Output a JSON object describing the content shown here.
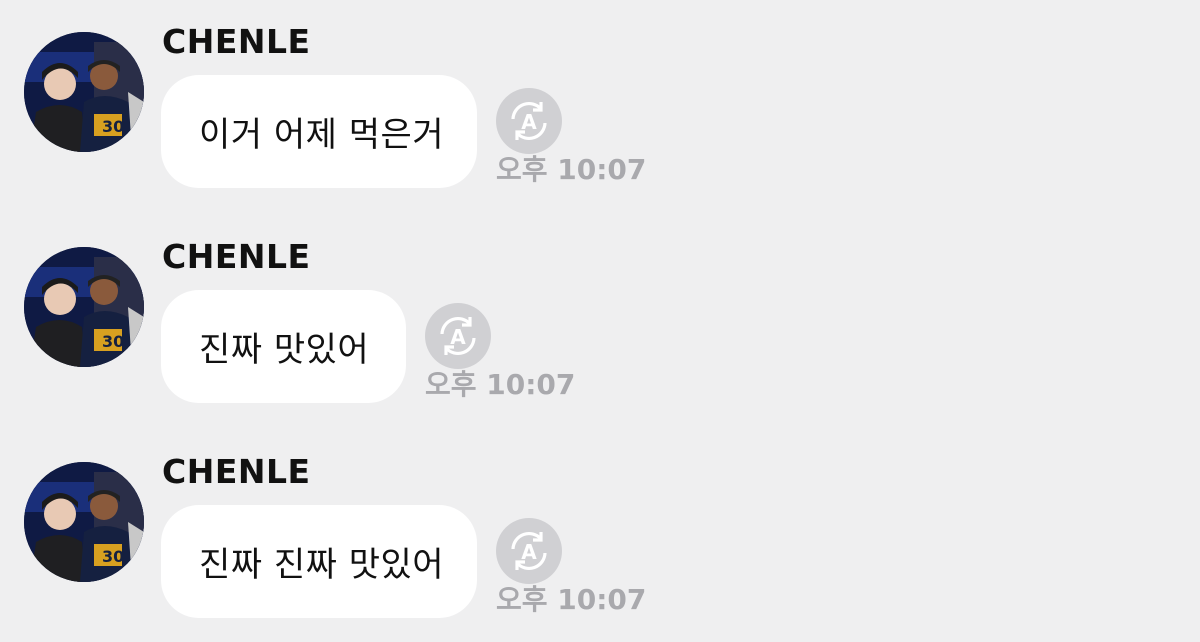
{
  "chat": {
    "messages": [
      {
        "sender": "CHENLE",
        "text": "이거 어제 먹은거",
        "time": "오후 10:07",
        "status_icon": "auto-translate-icon"
      },
      {
        "sender": "CHENLE",
        "text": "진짜 맛있어",
        "time": "오후 10:07",
        "status_icon": "auto-translate-icon"
      },
      {
        "sender": "CHENLE",
        "text": "진짜 진짜 맛있어",
        "time": "오후 10:07",
        "status_icon": "auto-translate-icon"
      }
    ]
  },
  "colors": {
    "background": "#efeff0",
    "bubble": "#ffffff",
    "icon": "#d0d0d3",
    "timestamp": "#a9a9ad"
  }
}
